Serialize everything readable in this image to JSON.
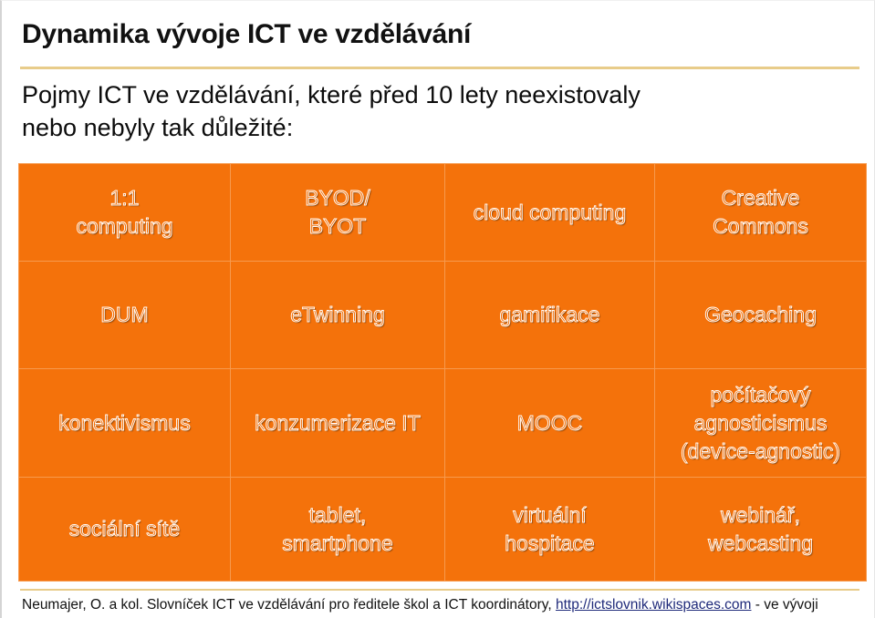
{
  "slide": {
    "title": "Dynamika vývoje ICT ve vzdělávání",
    "subtitle_line_1": "Pojmy ICT ve vzdělávání, které před 10 lety neexistovaly",
    "subtitle_line_2": "nebo nebyly tak důležité:",
    "accent_rule_color": "#E8CC8A",
    "table_fill_color": "#F4720B",
    "table_gridline_color": "#F79A4E",
    "text_outline_color": "#FFFFFF",
    "link_color": "#1F2A7A"
  },
  "table": {
    "rows": [
      {
        "cells": [
          {
            "lines": [
              "1:1",
              "computing"
            ]
          },
          {
            "lines": [
              "BYOD/",
              "BYOT"
            ]
          },
          {
            "lines": [
              "cloud computing"
            ]
          },
          {
            "lines": [
              "Creative",
              "Commons"
            ]
          }
        ]
      },
      {
        "cells": [
          {
            "lines": [
              "DUM"
            ]
          },
          {
            "lines": [
              "eTwinning"
            ]
          },
          {
            "lines": [
              "gamifikace"
            ]
          },
          {
            "lines": [
              "Geocaching"
            ]
          }
        ]
      },
      {
        "cells": [
          {
            "lines": [
              "konektivismus"
            ]
          },
          {
            "lines": [
              "konzumerizace IT"
            ]
          },
          {
            "lines": [
              "MOOC"
            ]
          },
          {
            "lines": [
              "počítačový",
              "agnosticismus",
              "(device-agnostic)"
            ]
          }
        ]
      },
      {
        "cells": [
          {
            "lines": [
              "sociální sítě"
            ]
          },
          {
            "lines": [
              "tablet,",
              "smartphone"
            ]
          },
          {
            "lines": [
              "virtuální",
              "hospitace"
            ]
          },
          {
            "lines": [
              "webinář,",
              "webcasting"
            ]
          }
        ]
      }
    ]
  },
  "footer": {
    "prefix": "Neumajer, O. a kol. Slovníček ICT ve vzdělávání pro ředitele škol a ICT koordinátory, ",
    "url": "http://ictslovnik.wikispaces.com",
    "suffix": " - ve vývoji"
  }
}
